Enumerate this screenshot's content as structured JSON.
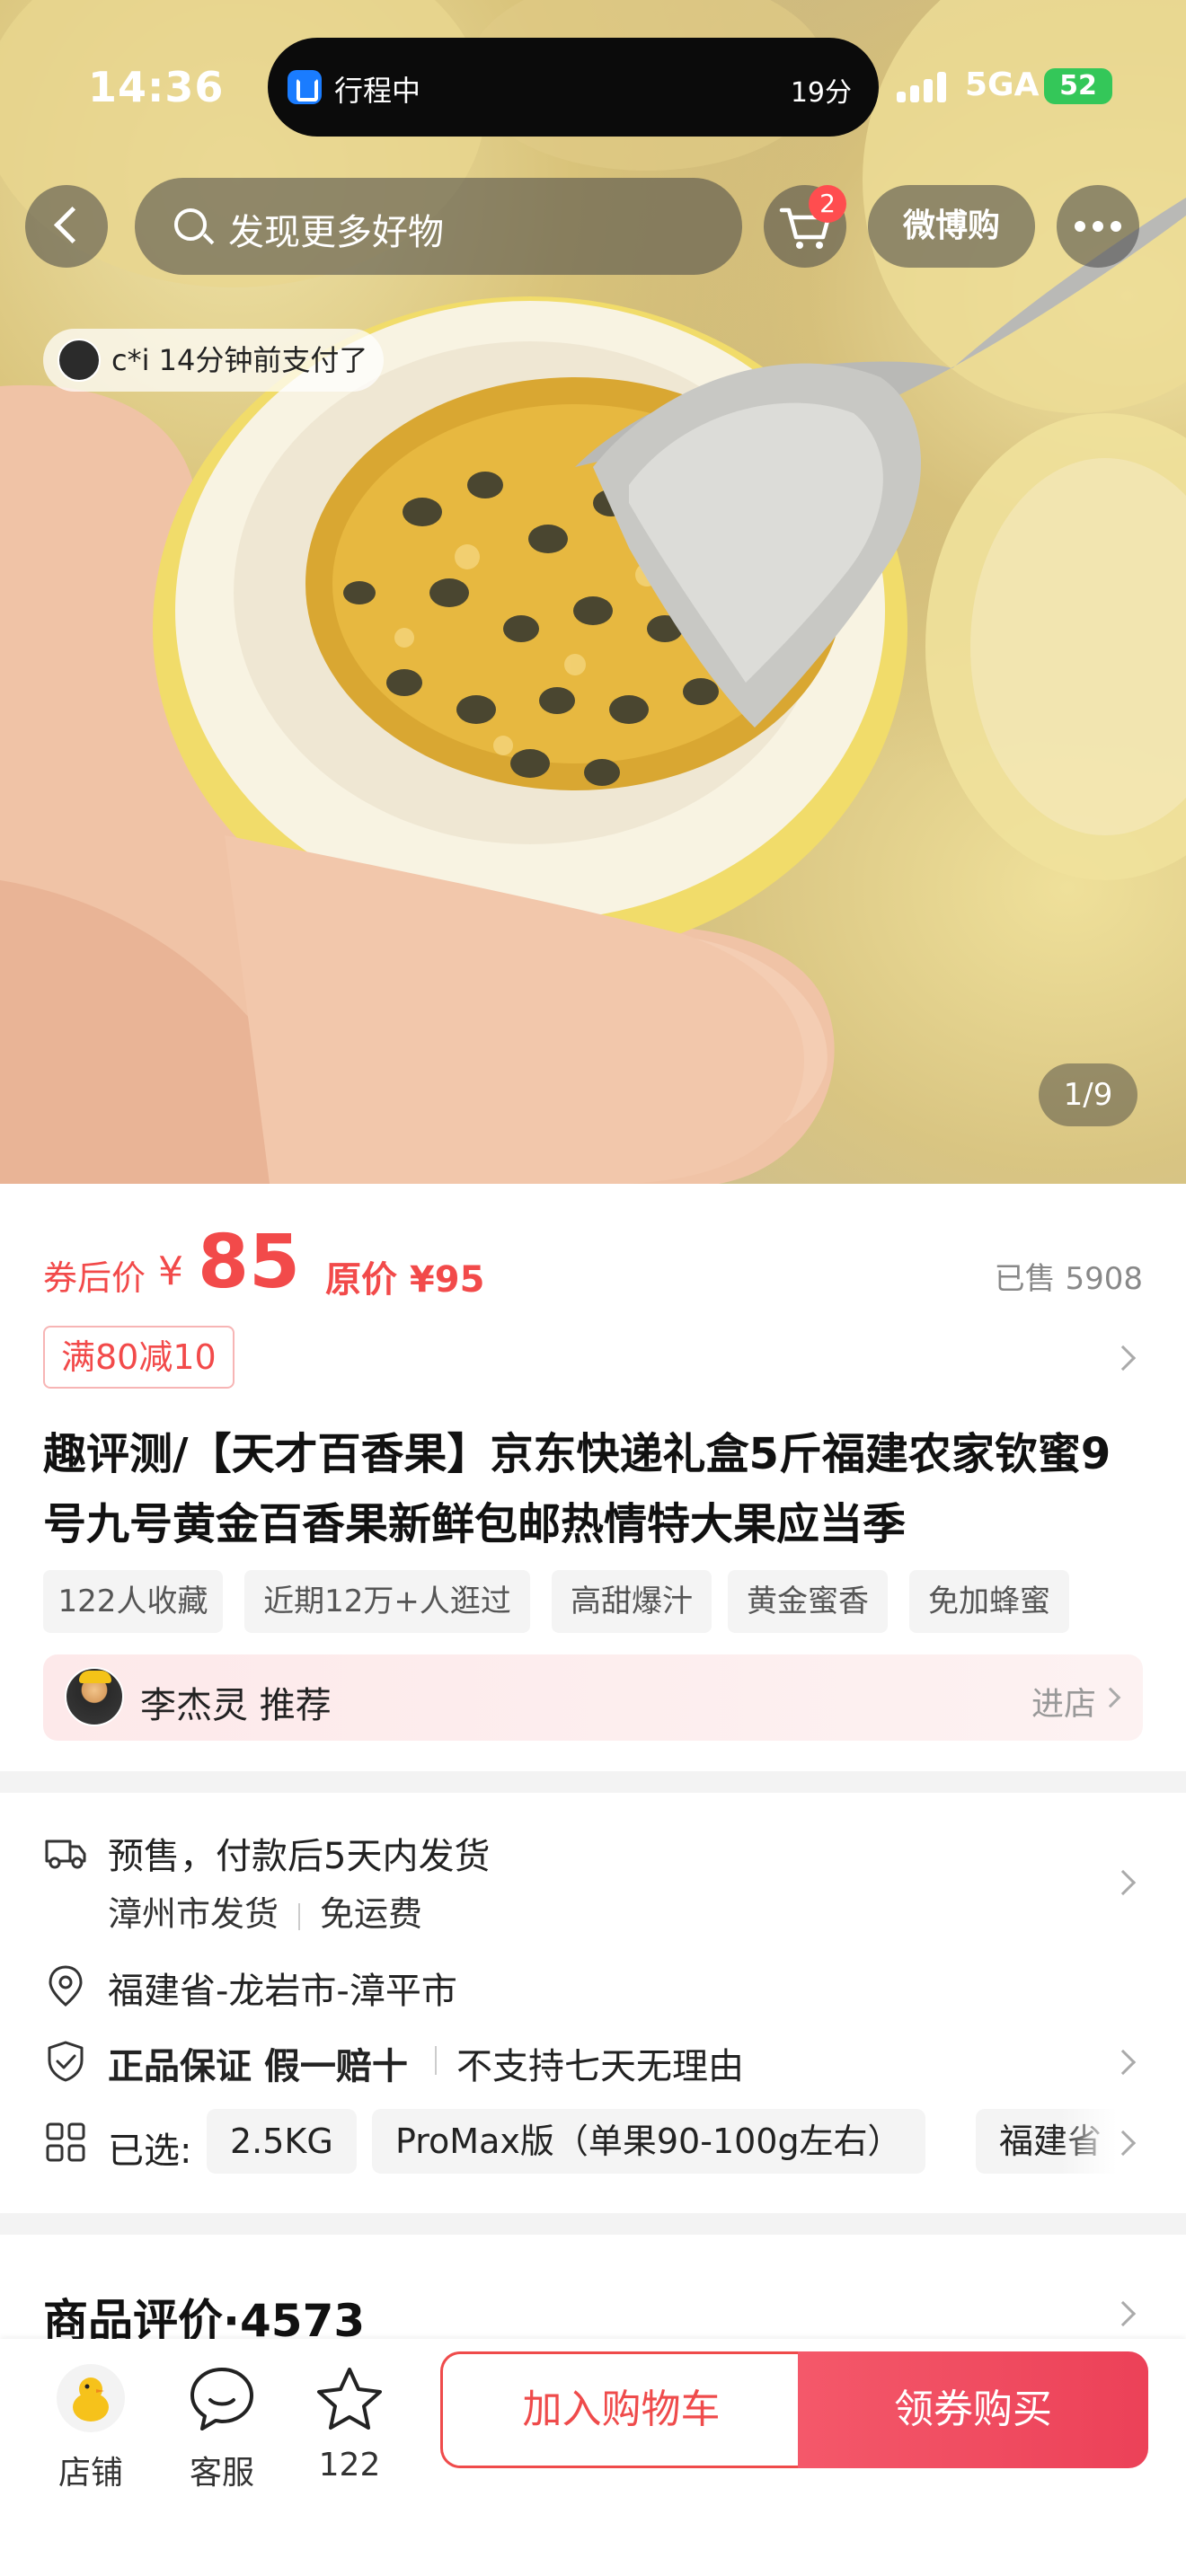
{
  "status_bar": {
    "time": "14:36",
    "activity": "行程中",
    "activity_time": "19分",
    "network": "5GA",
    "battery": "52"
  },
  "nav": {
    "search_placeholder": "发现更多好物",
    "cart_count": "2",
    "weibo_buy": "微博购"
  },
  "hero": {
    "recent_purchase": "c*i 14分钟前支付了",
    "page_indicator": "1/9"
  },
  "price": {
    "coupon_label": "券后价",
    "currency": "¥",
    "value": "85",
    "original": "原价 ¥95",
    "sold": "已售 5908"
  },
  "promo": {
    "label": "满80减10"
  },
  "product": {
    "title": "趣评测/【天才百香果】京东快递礼盒5斤福建农家钦蜜9号九号黄金百香果新鲜包邮热情特大果应当季"
  },
  "tags": [
    "122人收藏",
    "近期12万+人逛过",
    "高甜爆汁",
    "黄金蜜香",
    "免加蜂蜜"
  ],
  "recommend": {
    "name": "李杰灵 推荐",
    "enter": "进店"
  },
  "shipping": {
    "line1": "预售，付款后5天内发货",
    "origin": "漳州市发货",
    "fee": "免运费"
  },
  "location": {
    "address": "福建省-龙岩市-漳平市"
  },
  "guarantee": {
    "title": "正品保证 假一赔十",
    "note": "不支持七天无理由"
  },
  "specs": {
    "label": "已选:",
    "chips": [
      "2.5KG",
      "ProMax版（单果90-100g左右）",
      "福建省"
    ]
  },
  "reviews": {
    "title": "商品评价·4573"
  },
  "bottom_bar": {
    "shop": "店铺",
    "service": "客服",
    "favorites": "122",
    "add_to_cart": "加入购物车",
    "buy": "领券购买"
  },
  "colors": {
    "accent": "#f24a4a",
    "buy_button": "#ec4158",
    "tag_bg": "#f4f4f4"
  }
}
